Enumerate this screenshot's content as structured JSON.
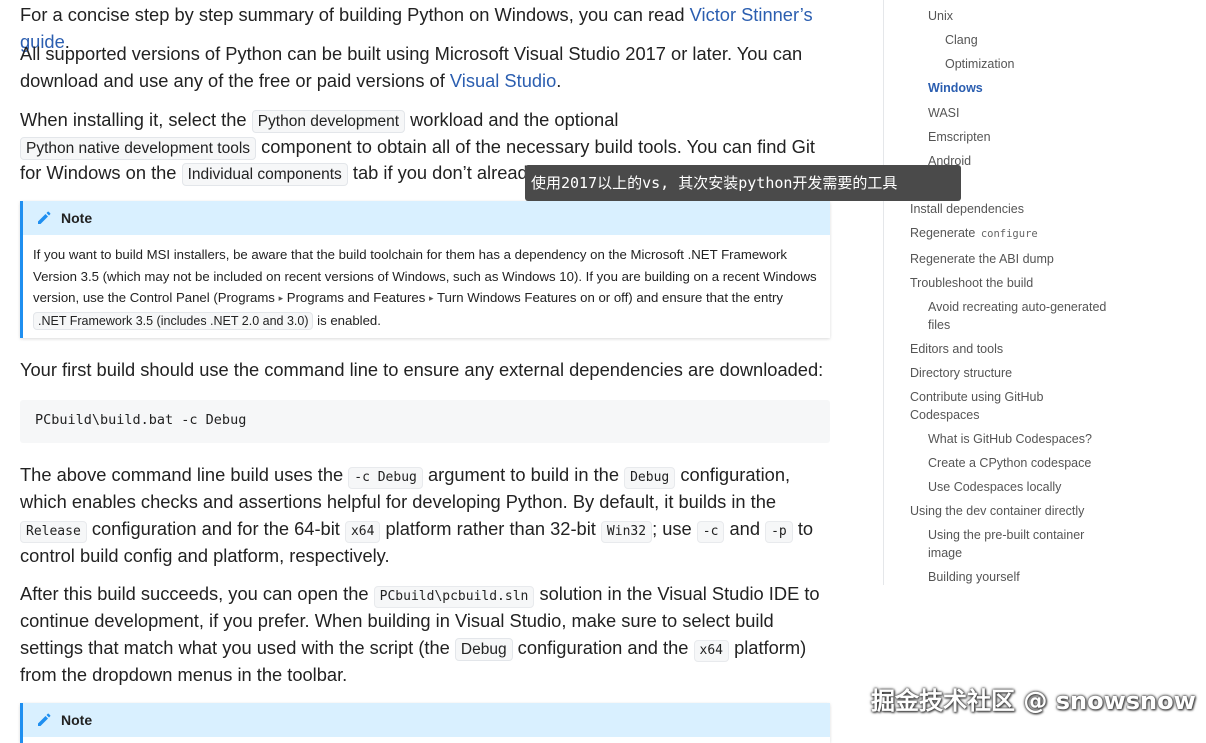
{
  "main": {
    "p1_text": "For a concise step by step summary of building Python on Windows, you can read ",
    "p1_link": "Victor Stinner’s guide",
    "p1_end": ".",
    "p2_text": "All supported versions of Python can be built using Microsoft Visual Studio 2017 or later. You can download and use any of the free or paid versions of ",
    "p2_link": "Visual Studio",
    "p2_end": ".",
    "p3_a": "When installing it, select the ",
    "p3_chip1": "Python development",
    "p3_b": " workload and the optional ",
    "p3_chip2": "Python native development tools",
    "p3_c": " component to obtain all of the necessary build tools. You can find Git for Windows on the ",
    "p3_chip3": "Individual components",
    "p3_d": " tab if you don’t already have it installed.",
    "note1": {
      "title": "Note",
      "body_a": "If you want to build MSI installers, be aware that the build toolchain for them has a dependency on the Microsoft .NET Framework Version 3.5 (which may not be included on recent versions of Windows, such as Windows 10). If you are building on a recent Windows version, use the Control Panel (",
      "menu1": "Programs",
      "menu2": "Programs and Features",
      "menu3": "Turn Windows Features on or off",
      "body_b": ") and ensure that the entry ",
      "chip": ".NET Framework 3.5 (includes .NET 2.0 and 3.0)",
      "body_c": " is enabled."
    },
    "p4": "Your first build should use the command line to ensure any external dependencies are downloaded:",
    "code_block": "PCbuild\\build.bat -c Debug",
    "p5_a": "The above command line build uses the ",
    "p5_c1": "-c Debug",
    "p5_b": " argument to build in the ",
    "p5_c2": "Debug",
    "p5_c": " configuration, which enables checks and assertions helpful for developing Python. By default, it builds in the ",
    "p5_c3": "Release",
    "p5_d": " configuration and for the 64-bit ",
    "p5_c4": "x64",
    "p5_e": " platform rather than 32-bit ",
    "p5_c5": "Win32",
    "p5_f": "; use ",
    "p5_c6": "-c",
    "p5_g": " and ",
    "p5_c7": "-p",
    "p5_h": " to control build config and platform, respectively.",
    "p6_a": "After this build succeeds, you can open the ",
    "p6_c1": "PCbuild\\pcbuild.sln",
    "p6_b": " solution in the Visual Studio IDE to continue development, if you prefer. When building in Visual Studio, make sure to select build settings that match what you used with the script (the ",
    "p6_c2": "Debug",
    "p6_c": " configuration and the ",
    "p6_c3": "x64",
    "p6_d": " platform) from the dropdown menus in the toolbar.",
    "note2": {
      "title": "Note"
    }
  },
  "toc": {
    "unix": "Unix",
    "clang": "Clang",
    "optimization": "Optimization",
    "windows": "Windows",
    "wasi": "WASI",
    "emscripten": "Emscripten",
    "android": "Android",
    "install_deps": "Install dependencies",
    "regenerate": "Regenerate ",
    "regenerate_code": "configure",
    "regen_abi": "Regenerate the ABI dump",
    "troubleshoot": "Troubleshoot the build",
    "avoid_1": "Avoid recreating auto-generated",
    "avoid_2": "files",
    "editors": "Editors and tools",
    "directory": "Directory structure",
    "contribute_1": "Contribute using GitHub",
    "contribute_2": "Codespaces",
    "what_is": "What is GitHub Codespaces?",
    "create": "Create a CPython codespace",
    "use_locally": "Use Codespaces locally",
    "dev_container": "Using the dev container directly",
    "prebuilt_1": "Using the pre-built container",
    "prebuilt_2": "image",
    "building_yourself": "Building yourself"
  },
  "tooltip": "使用2017以上的vs, 其次安装python开发需要的工具",
  "watermark": "掘金技术社区 @ snowsnow",
  "colors": {
    "link": "#2b5eb0",
    "note_header_bg": "#d9f0ff",
    "note_border": "#1f8ff0"
  }
}
